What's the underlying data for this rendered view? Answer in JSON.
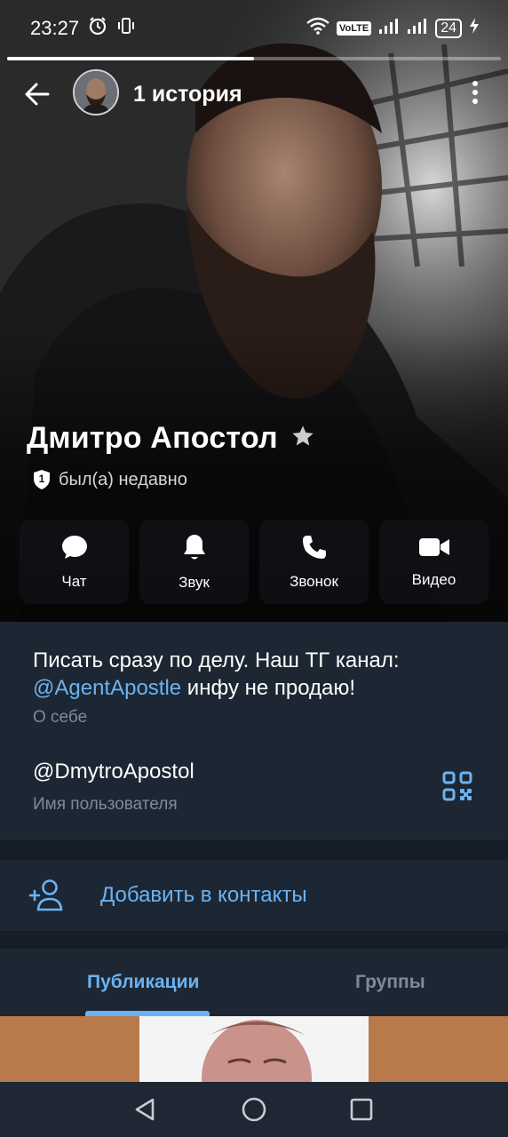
{
  "status_bar": {
    "time": "23:27",
    "network_badge": "VoLTE",
    "battery": "24",
    "icons": [
      "alarm-icon",
      "vibrate-icon",
      "wifi-icon",
      "volte-icon",
      "signal-icon",
      "signal-icon",
      "battery-icon",
      "charging-icon"
    ]
  },
  "story": {
    "title": "1 история",
    "progress": 0.5
  },
  "profile": {
    "name": "Дмитро Апостол",
    "status_badge": "1",
    "status": "был(а) недавно"
  },
  "actions": [
    {
      "label": "Чат",
      "icon": "chat-icon"
    },
    {
      "label": "Звук",
      "icon": "bell-icon"
    },
    {
      "label": "Звонок",
      "icon": "phone-icon"
    },
    {
      "label": "Видео",
      "icon": "video-icon"
    }
  ],
  "bio": {
    "text_before": "Писать сразу по делу. Наш ТГ канал: ",
    "link": "@AgentApostle",
    "text_after": " инфу не продаю!",
    "caption": "О себе"
  },
  "username": {
    "value": "@DmytroApostol",
    "caption": "Имя пользователя"
  },
  "add_contact": {
    "label": "Добавить в контакты"
  },
  "tabs": [
    {
      "label": "Публикации",
      "active": true
    },
    {
      "label": "Группы",
      "active": false
    }
  ],
  "colors": {
    "accent": "#6ab3f3",
    "background": "#17212b",
    "card": "#1d2733",
    "muted": "#7d8b99"
  }
}
